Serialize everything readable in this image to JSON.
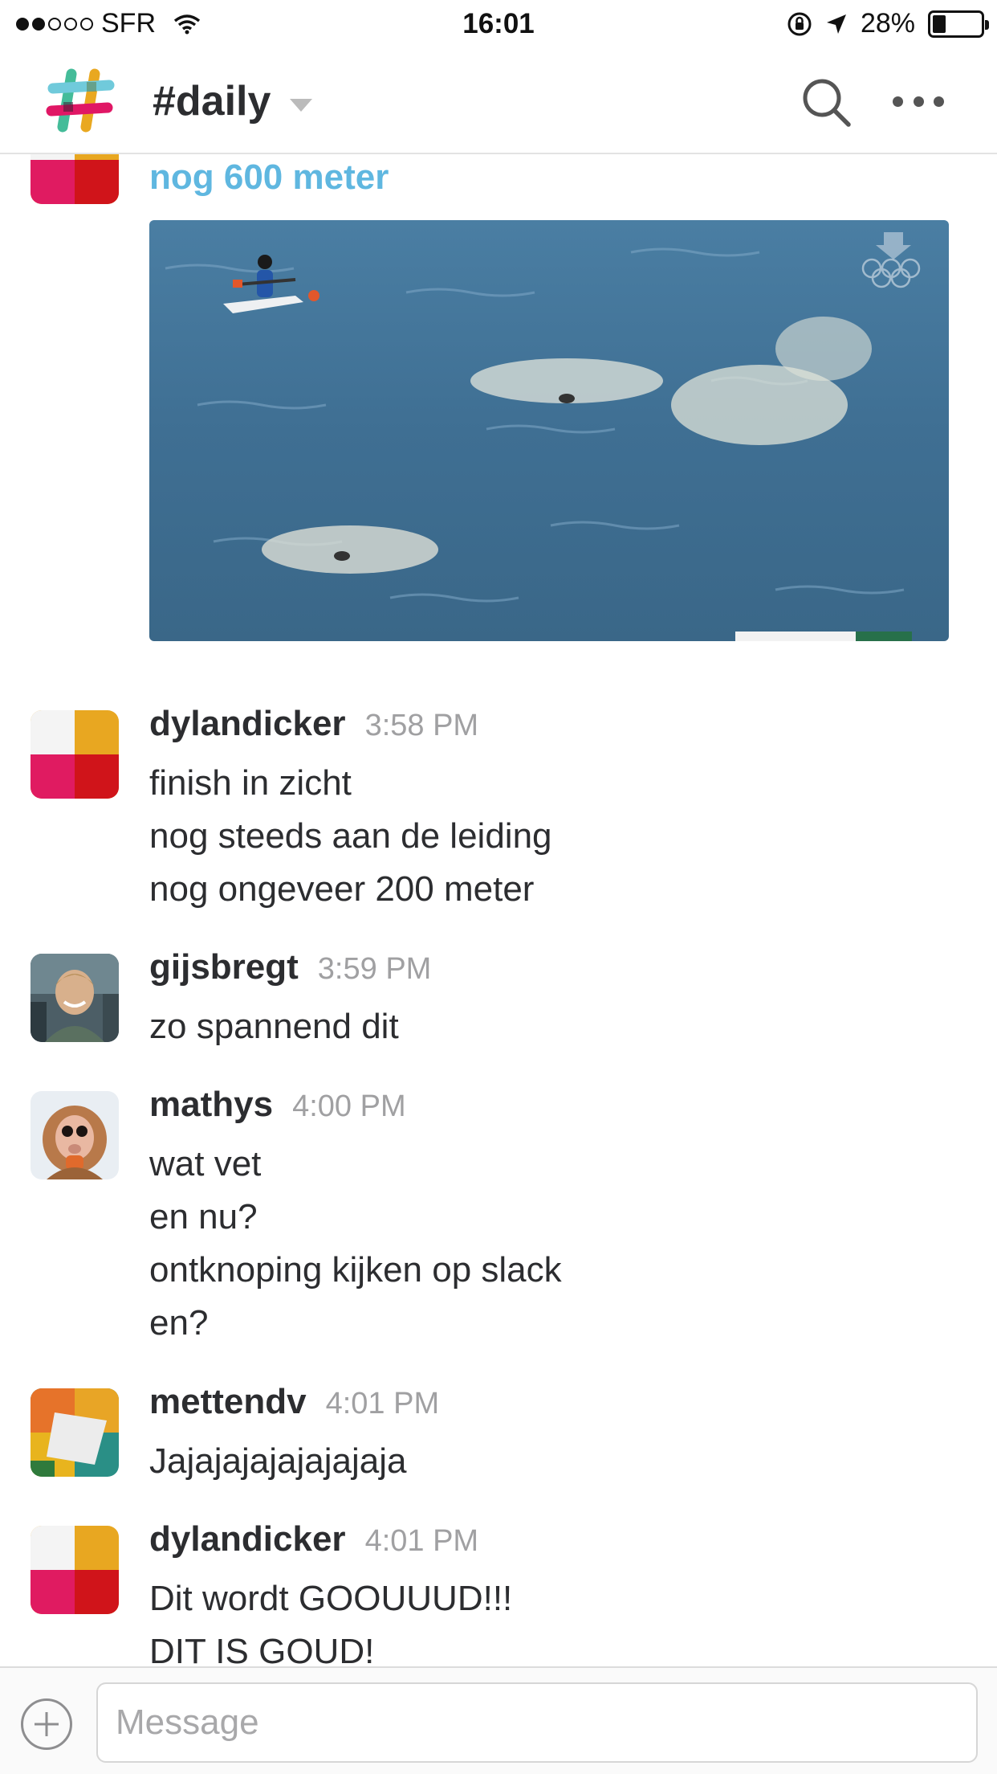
{
  "status_bar": {
    "carrier": "SFR",
    "time": "16:01",
    "battery_percent": "28%",
    "battery_level": 0.28,
    "signal_bars_filled": 2,
    "signal_bars_total": 5,
    "icons": [
      "wifi-icon",
      "rotation-lock-icon",
      "location-arrow-icon",
      "battery-icon"
    ]
  },
  "header": {
    "channel": "#daily",
    "icons": [
      "slack-logo-icon",
      "chevron-down-icon",
      "search-icon",
      "more-icon"
    ]
  },
  "feed": {
    "link_title": "nog 600 meter",
    "messages": [
      {
        "author": "dylandicker",
        "time": "3:58 PM",
        "lines": [
          "finish in zicht",
          "nog steeds aan de leiding",
          "nog ongeveer 200 meter"
        ]
      },
      {
        "author": "gijsbregt",
        "time": "3:59 PM",
        "lines": [
          "zo spannend dit"
        ]
      },
      {
        "author": "mathys",
        "time": "4:00 PM",
        "lines": [
          "wat vet",
          "en nu?",
          "ontknoping kijken op slack",
          "en?"
        ]
      },
      {
        "author": "mettendv",
        "time": "4:01 PM",
        "lines": [
          "Jajajajajajajajaja"
        ]
      },
      {
        "author": "dylandicker",
        "time": "4:01 PM",
        "lines": [
          "Dit wordt GOOUUUD!!!",
          "DIT IS GOUD!"
        ]
      }
    ]
  },
  "composer": {
    "placeholder": "Message"
  },
  "colors": {
    "link": "#5fb7e0",
    "text": "#2c2d30",
    "timestamp": "#a0a0a2",
    "water": "#3d6f92"
  }
}
